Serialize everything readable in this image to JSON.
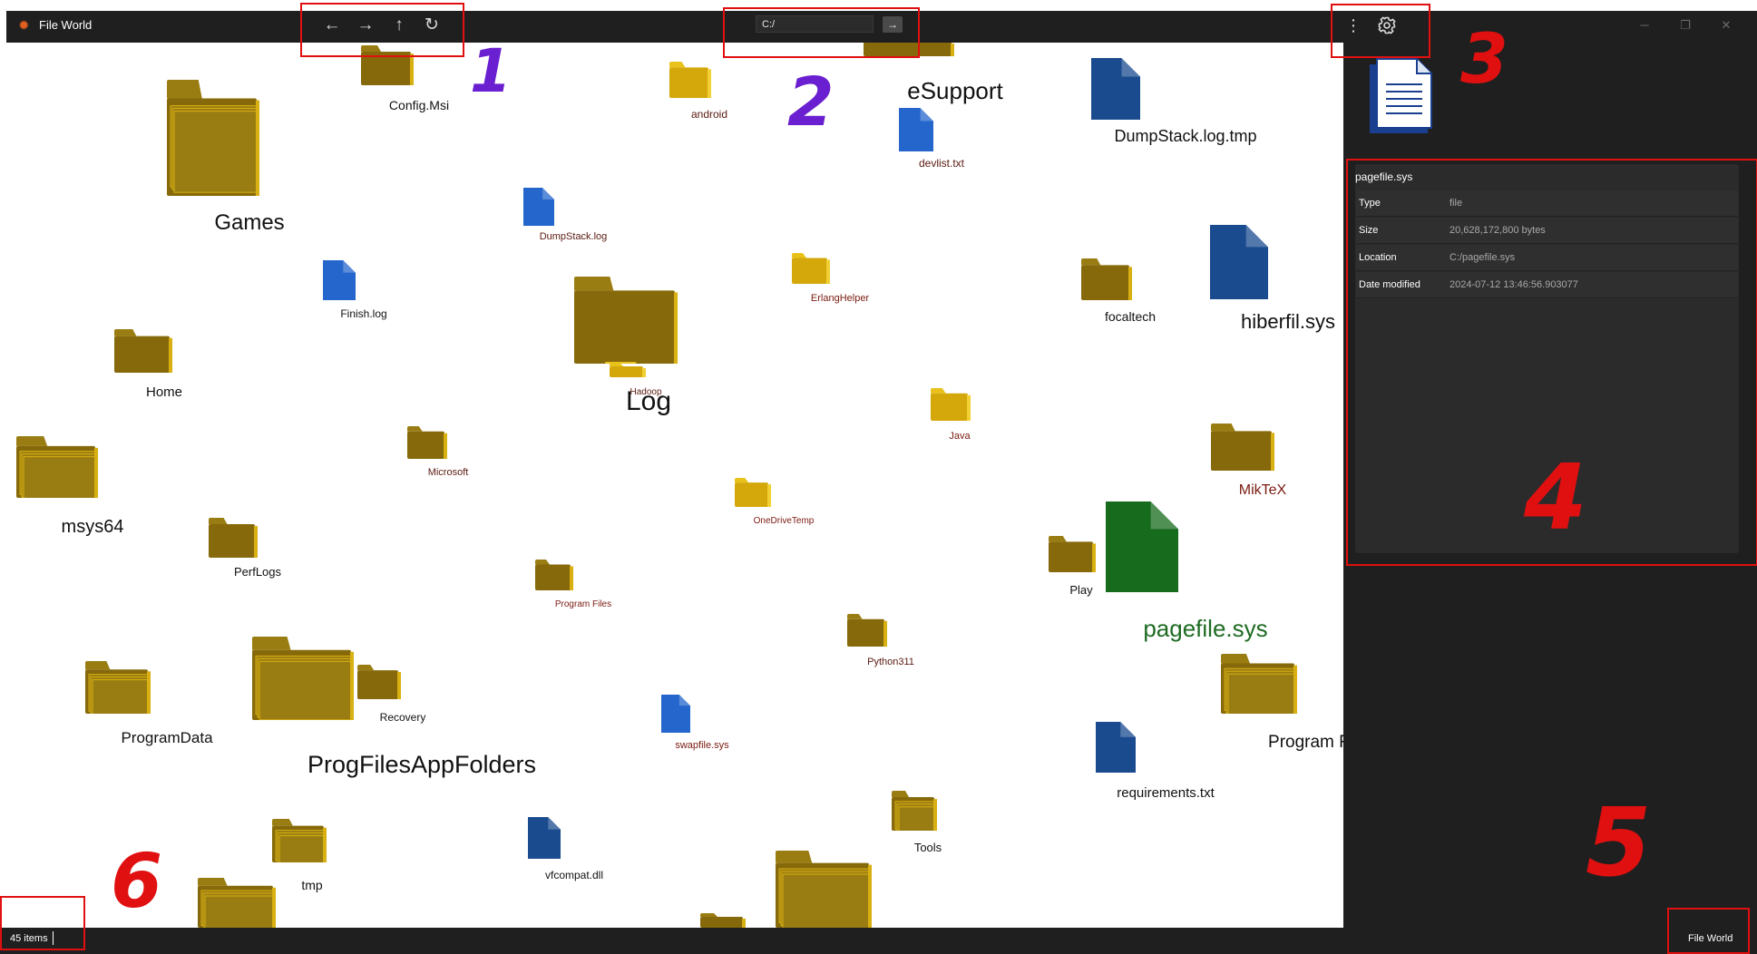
{
  "app": {
    "title": "File World",
    "icon": "sun-icon"
  },
  "toolbar": {
    "back_icon": "←",
    "forward_icon": "→",
    "up_icon": "↑",
    "refresh_icon": "↻",
    "address_value": "C:/",
    "go_icon": "→",
    "menu_icon": "⋮",
    "settings_icon": "gear-icon"
  },
  "window_controls": {
    "minimize": "─",
    "maximize": "❐",
    "close": "✕"
  },
  "details": {
    "file_name": "pagefile.sys",
    "preview_icon": "document-icon",
    "rows": [
      {
        "key": "Type",
        "value": "file"
      },
      {
        "key": "Size",
        "value": "20,628,172,800 bytes"
      },
      {
        "key": "Location",
        "value": "C:/pagefile.sys"
      },
      {
        "key": "Date modified",
        "value": "2024-07-12 13:46:56.903077"
      }
    ]
  },
  "status": {
    "item_count": "45 items",
    "app_name": "File World"
  },
  "items": [
    {
      "label": "Config.Msi",
      "kind": "folder",
      "label_color": "#111111"
    },
    {
      "label": "android",
      "kind": "folder",
      "label_color": "#5a1a10"
    },
    {
      "label": "eSupport",
      "kind": "folder",
      "label_color": "#111111"
    },
    {
      "label": "DumpStack.log.tmp",
      "kind": "file",
      "label_color": "#111111"
    },
    {
      "label": "devlist.txt",
      "kind": "file",
      "label_color": "#5a1a10"
    },
    {
      "label": "Games",
      "kind": "folder",
      "label_color": "#111111"
    },
    {
      "label": "DumpStack.log",
      "kind": "file",
      "label_color": "#5a1a10"
    },
    {
      "label": "ErlangHelper",
      "kind": "folder",
      "label_color": "#7a1a10"
    },
    {
      "label": "focaltech",
      "kind": "folder",
      "label_color": "#111111"
    },
    {
      "label": "hiberfil.sys",
      "kind": "file",
      "label_color": "#111111"
    },
    {
      "label": "Finish.log",
      "kind": "file",
      "label_color": "#111111"
    },
    {
      "label": "Log",
      "kind": "folder",
      "label_color": "#111111"
    },
    {
      "label": "Hadoop",
      "kind": "folder",
      "label_color": "#5a1a10"
    },
    {
      "label": "Home",
      "kind": "folder",
      "label_color": "#111111"
    },
    {
      "label": "Java",
      "kind": "folder",
      "label_color": "#7a1a10"
    },
    {
      "label": "Microsoft",
      "kind": "folder",
      "label_color": "#5a1a10"
    },
    {
      "label": "msys64",
      "kind": "folder",
      "label_color": "#111111"
    },
    {
      "label": "MikTeX",
      "kind": "folder",
      "label_color": "#7a1a10"
    },
    {
      "label": "OneDriveTemp",
      "kind": "folder",
      "label_color": "#7a1a10"
    },
    {
      "label": "PerfLogs",
      "kind": "folder",
      "label_color": "#111111"
    },
    {
      "label": "Play",
      "kind": "folder",
      "label_color": "#111111"
    },
    {
      "label": "pagefile.sys",
      "kind": "file",
      "label_color": "#1e6b22"
    },
    {
      "label": "Program Files",
      "kind": "folder",
      "label_color": "#7a1a10"
    },
    {
      "label": "Python311",
      "kind": "folder",
      "label_color": "#5a1a10"
    },
    {
      "label": "ProgramData",
      "kind": "folder",
      "label_color": "#111111"
    },
    {
      "label": "Recovery",
      "kind": "folder",
      "label_color": "#111111"
    },
    {
      "label": "ProgFilesAppFolders",
      "kind": "folder",
      "label_color": "#111111"
    },
    {
      "label": "swapfile.sys",
      "kind": "file",
      "label_color": "#7a1a10"
    },
    {
      "label": "Program Fi",
      "kind": "folder",
      "label_color": "#111111"
    },
    {
      "label": "requirements.txt",
      "kind": "file",
      "label_color": "#111111"
    },
    {
      "label": "tmp",
      "kind": "folder",
      "label_color": "#111111"
    },
    {
      "label": "vfcompat.dll",
      "kind": "file",
      "label_color": "#111111"
    },
    {
      "label": "Tools",
      "kind": "folder",
      "label_color": "#111111"
    },
    {
      "label": "",
      "kind": "folder",
      "label_color": "#111111"
    },
    {
      "label": "",
      "kind": "folder",
      "label_color": "#111111"
    },
    {
      "label": "",
      "kind": "folder",
      "label_color": "#111111"
    }
  ],
  "annotations": {
    "numbers": [
      "1",
      "2",
      "3",
      "4",
      "5",
      "6"
    ],
    "color_purple": "#6a1fd0",
    "color_red": "#e01010"
  }
}
